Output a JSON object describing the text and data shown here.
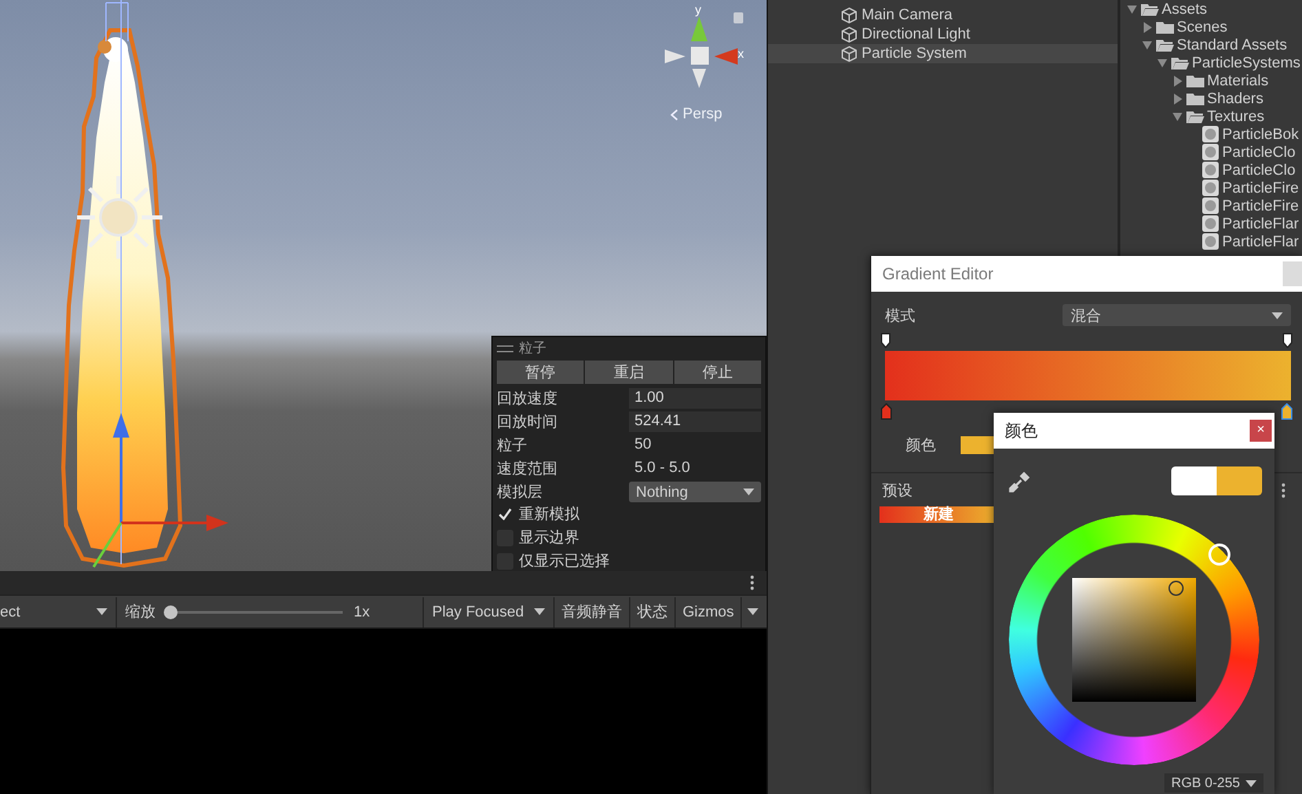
{
  "scene": {
    "axis_y": "y",
    "axis_x": "x",
    "projection": "Persp"
  },
  "particle_panel": {
    "title": "粒子",
    "buttons": [
      "暂停",
      "重启",
      "停止"
    ],
    "rows": [
      {
        "kind": "field",
        "label": "回放速度",
        "value": "1.00"
      },
      {
        "kind": "field",
        "label": "回放时间",
        "value": "524.41"
      },
      {
        "kind": "text",
        "label": "粒子",
        "value": "50"
      },
      {
        "kind": "text",
        "label": "速度范围",
        "value": "5.0 - 5.0"
      },
      {
        "kind": "dropdown",
        "label": "模拟层",
        "value": "Nothing"
      }
    ],
    "options": [
      {
        "label": "重新模拟",
        "checked": true
      },
      {
        "label": "显示边界",
        "checked": false
      },
      {
        "label": "仅显示已选择",
        "checked": false
      }
    ]
  },
  "scene_toolbar": {
    "items": [
      {
        "kind": "dropdown",
        "label": "ect"
      },
      {
        "kind": "slider",
        "label": "缩放",
        "level": 0,
        "reading": "1x"
      },
      {
        "kind": "dropdown",
        "label": "Play Focused"
      },
      {
        "kind": "toggle",
        "label": "音频静音",
        "on": false
      },
      {
        "kind": "toggle",
        "label": "状态",
        "on": false
      },
      {
        "kind": "split",
        "label": "Gizmos"
      }
    ]
  },
  "hierarchy": {
    "items": [
      {
        "label": "Main Camera",
        "selected": false
      },
      {
        "label": "Directional Light",
        "selected": false
      },
      {
        "label": "Particle System",
        "selected": true
      }
    ]
  },
  "project": {
    "tree": [
      {
        "label": "Assets",
        "kind": "folder",
        "expanded": true,
        "children": [
          {
            "label": "Scenes",
            "kind": "folder",
            "expanded": false
          },
          {
            "label": "Standard Assets",
            "kind": "folder",
            "expanded": true,
            "children": [
              {
                "label": "ParticleSystems",
                "kind": "folder",
                "expanded": true,
                "children": [
                  {
                    "label": "Materials",
                    "kind": "folder",
                    "expanded": false
                  },
                  {
                    "label": "Shaders",
                    "kind": "folder",
                    "expanded": false
                  },
                  {
                    "label": "Textures",
                    "kind": "folder",
                    "expanded": true,
                    "children": [
                      {
                        "label": "ParticleBok",
                        "kind": "texture"
                      },
                      {
                        "label": "ParticleClo",
                        "kind": "texture"
                      },
                      {
                        "label": "ParticleClo",
                        "kind": "texture"
                      },
                      {
                        "label": "ParticleFire",
                        "kind": "texture"
                      },
                      {
                        "label": "ParticleFire",
                        "kind": "texture"
                      },
                      {
                        "label": "ParticleFlar",
                        "kind": "texture"
                      },
                      {
                        "label": "ParticleFlar",
                        "kind": "texture"
                      }
                    ]
                  }
                ]
              }
            ]
          }
        ]
      }
    ]
  },
  "gradient_editor": {
    "title": "Gradient Editor",
    "mode_label": "模式",
    "mode_value": "混合",
    "alpha_keys": [
      {
        "selected": false
      },
      {
        "selected": false
      }
    ],
    "color_keys": [
      {
        "color": "#e3301c",
        "selected": false
      },
      {
        "color": "#ecb22e",
        "selected": true
      }
    ],
    "color_label": "颜色",
    "presets_label": "预设",
    "presets": [
      {
        "label": "新建"
      }
    ]
  },
  "color_picker": {
    "title": "颜色",
    "close": "×",
    "mode": "RGB 0-255"
  }
}
